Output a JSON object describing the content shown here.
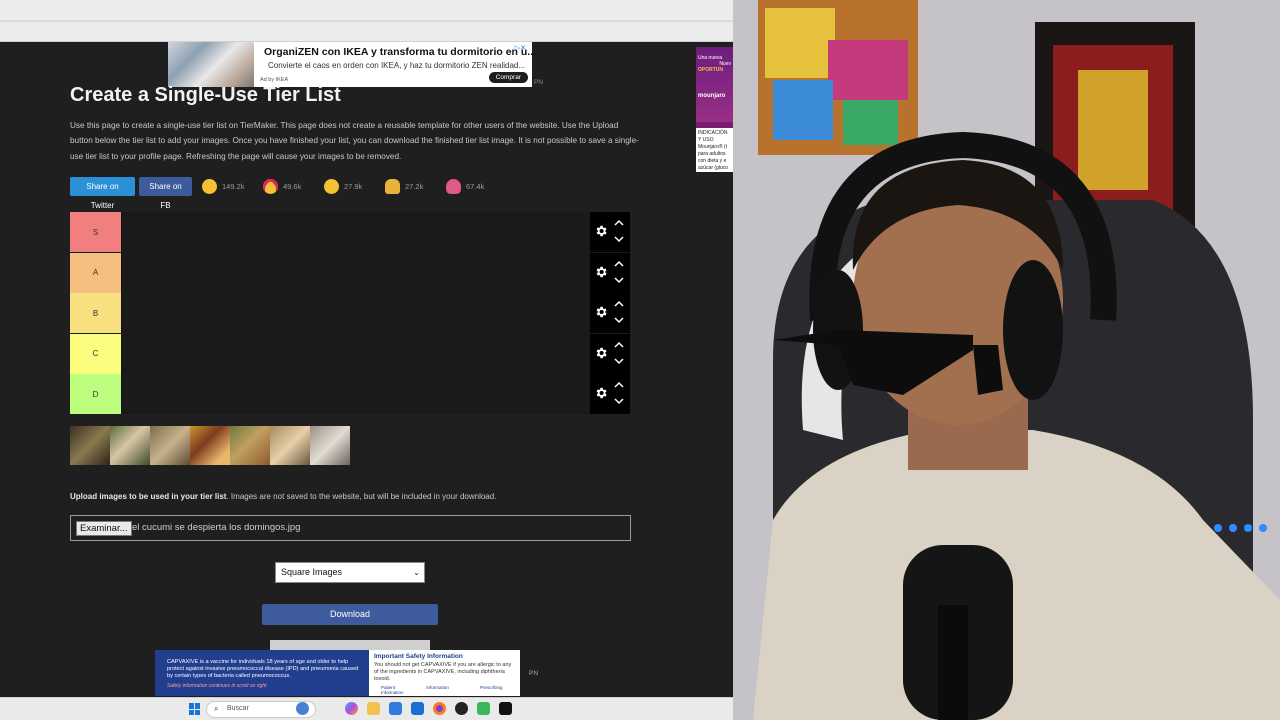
{
  "ads": {
    "top": {
      "title": "OrganiZEN con IKEA y transforma tu dormitorio en u...",
      "subtitle": "Convierte el caos en orden con IKEA, y haz tu dormitorio ZEN realidad...",
      "by": "Ad by IKEA",
      "button": "Comprar",
      "pn": "PN"
    },
    "side": {
      "line1": "Una nueva",
      "line2": "Nuev",
      "line3": "OPORTUN",
      "brand": "mounjaro",
      "text": "INDICACIÓN Y USO Mounjaro® (t para adultos con dieta y e azúcar (gluco",
      "link": "Se des"
    },
    "bottom": {
      "left_text": "CAPVAXIVE is a vaccine for individuals 18 years of age and older to help protect against invasive pneumococcal disease (IPD) and pneumonia caused by certain types of bacteria called pneumococcus.",
      "left_note": "Safety information continues in scroll on right",
      "right_title": "Important Safety Information",
      "right_text": "You should not get CAPVAXIVE if you are allergic to any of the ingredients in CAPVAXIVE, including diphtheria toxoid.",
      "links": "Patient Information Prescribing Information",
      "pn": "PN"
    }
  },
  "page": {
    "title": "Create a Single-Use Tier List",
    "intro": "Use this page to create a single-use tier list on TierMaker. This page does not create a reusable template for other users of the website. Use the Upload button below the tier list to add your images. Once you have finished your list, you can download the finished tier list image. It is not possible to save a single-use tier list to your profile page. Refreshing the page will cause your images to be removed."
  },
  "share": {
    "twitter": "Share on Twitter",
    "facebook": "Share on FB",
    "reactions": [
      {
        "icon": "smile-emoji-icon",
        "count": "149.2k",
        "color": "#f3c233"
      },
      {
        "icon": "heart-eyes-emoji-icon",
        "count": "49.6k",
        "color": "#f3c233"
      },
      {
        "icon": "laughing-emoji-icon",
        "count": "27.9k",
        "color": "#f3c233"
      },
      {
        "icon": "clap-emoji-icon",
        "count": "27.2k",
        "color": "#f3c233"
      },
      {
        "icon": "poop-emoji-icon",
        "count": "67.4k",
        "color": "#e05a86"
      }
    ]
  },
  "tiers": [
    {
      "label": "S",
      "color": "#f27f80"
    },
    {
      "label": "A",
      "color": "#f6bf7f"
    },
    {
      "label": "B",
      "color": "#f8df80"
    },
    {
      "label": "C",
      "color": "#fbfd7f"
    },
    {
      "label": "D",
      "color": "#bdfe7f"
    }
  ],
  "upload": {
    "label_bold": "Upload images to be used in your tier list",
    "label_rest": ". Images are not saved to the website, but will be included in your download.",
    "button": "Examinar...",
    "file_name": "el cucumi se despierta los domingos.jpg"
  },
  "select": {
    "value": "Square Images"
  },
  "download": "Download",
  "taskbar": {
    "search": "Buscar"
  }
}
